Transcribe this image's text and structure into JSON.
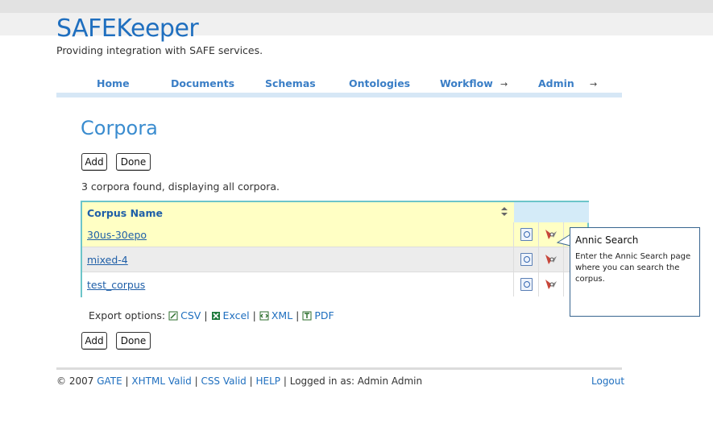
{
  "header": {
    "brand": "SAFEKeeper",
    "tagline": "Providing integration with SAFE services."
  },
  "nav": {
    "items": [
      {
        "label": "Home"
      },
      {
        "label": "Documents"
      },
      {
        "label": "Schemas"
      },
      {
        "label": "Ontologies"
      },
      {
        "label": "Workflow"
      },
      {
        "label": "Admin"
      }
    ],
    "arrow": "→"
  },
  "page": {
    "title": "Corpora",
    "add_label": "Add",
    "done_label": "Done",
    "count_text": "3 corpora found, displaying all corpora."
  },
  "table": {
    "header": "Corpus Name",
    "sort_glyph": "▲▼",
    "rows": [
      {
        "name": "30us-30epo"
      },
      {
        "name": "mixed-4"
      },
      {
        "name": "test_corpus"
      }
    ]
  },
  "export": {
    "label": "Export options:",
    "csv": "CSV",
    "excel": "Excel",
    "xml": "XML",
    "pdf": "PDF",
    "sep": "|"
  },
  "footer": {
    "copyright": "© 2007",
    "gate": "GATE",
    "xhtml": "XHTML Valid",
    "css": "CSS Valid",
    "help": "HELP",
    "logged_in": "Logged in as: Admin Admin",
    "sep": "|",
    "logout": "Logout"
  },
  "tooltip": {
    "title": "Annic Search",
    "body": "Enter the Annic Search page where you can search the corpus."
  },
  "colors": {
    "brand": "#1f6fbf",
    "title": "#3a8ccf",
    "grid_border": "#6cc5c9",
    "header_bg": "#ffffc4"
  }
}
